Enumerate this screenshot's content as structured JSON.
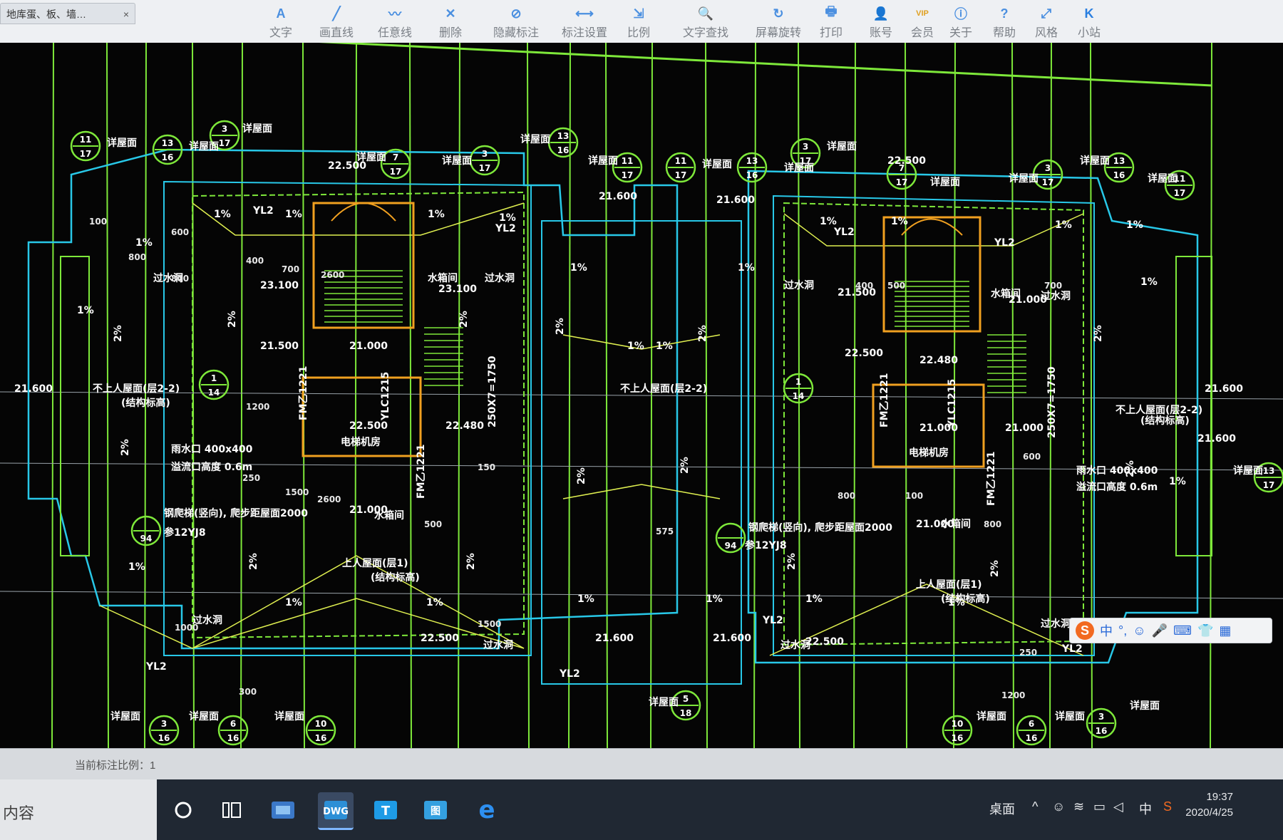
{
  "window": {
    "doc_tab": "地库蛋、板、墙…"
  },
  "toolbar": {
    "items": [
      {
        "label": "文字",
        "icon": "text-icon"
      },
      {
        "label": "画直线",
        "icon": "line-icon"
      },
      {
        "label": "任意线",
        "icon": "polyline-icon"
      },
      {
        "label": "删除",
        "icon": "delete-icon"
      },
      {
        "label": "隐藏标注",
        "icon": "hide-dimension-icon"
      },
      {
        "label": "标注设置",
        "icon": "dimension-settings-icon"
      },
      {
        "label": "比例",
        "icon": "scale-icon"
      },
      {
        "label": "文字查找",
        "icon": "text-search-icon"
      },
      {
        "label": "屏幕旋转",
        "icon": "rotate-screen-icon"
      },
      {
        "label": "打印",
        "icon": "print-icon"
      },
      {
        "label": "账号",
        "icon": "account-icon"
      },
      {
        "label": "会员",
        "icon": "vip-icon"
      },
      {
        "label": "关于",
        "icon": "info-icon"
      },
      {
        "label": "帮助",
        "icon": "help-icon"
      },
      {
        "label": "风格",
        "icon": "style-icon"
      },
      {
        "label": "小站",
        "icon": "k-station-icon"
      }
    ]
  },
  "drawing": {
    "elevations": [
      "22.500",
      "21.600",
      "21.600",
      "21.600",
      "23.100",
      "23.100",
      "21.500",
      "21.000",
      "21.500",
      "21.000",
      "22.500",
      "22.480",
      "22.500",
      "22.480",
      "21.000",
      "21.000",
      "21.600",
      "21.600",
      "22.500",
      "22.500",
      "22.500",
      "21.600",
      "21.600",
      "21.000",
      "21.000"
    ],
    "slopes": "1%",
    "slopes2": "2%",
    "labels": {
      "yl2": "YL2",
      "non_access_roof": "不上人屋面(层2-2)",
      "access_roof": "上人屋面(层1)",
      "structure_note": "(结构标高)",
      "drain": "过水洞",
      "water_tank": "水箱间",
      "elevator_room": "电梯机房",
      "scupper": "雨水口 400x400",
      "scupper_note": "溢流口高度 0.6m",
      "ladder_note": "钢爬梯(竖向), 爬步距屋面2000",
      "ladder_ref": "参12YJ8",
      "detail_ref": "详屋面",
      "door_fm": "FM乙1221",
      "door_ylc": "YLC1215",
      "stair_dim": "250X7=1750",
      "dims": [
        "400",
        "700",
        "800",
        "100",
        "800",
        "600",
        "1200",
        "250",
        "1500",
        "2600",
        "500",
        "150",
        "1000",
        "300",
        "575"
      ]
    },
    "callouts": [
      {
        "top": "11",
        "bottom": "17"
      },
      {
        "top": "13",
        "bottom": "16"
      },
      {
        "top": "3",
        "bottom": "17"
      },
      {
        "top": "7",
        "bottom": "17"
      },
      {
        "top": "3",
        "bottom": "17"
      },
      {
        "top": "13",
        "bottom": "16"
      },
      {
        "top": "11",
        "bottom": "17"
      },
      {
        "top": "11",
        "bottom": "17"
      },
      {
        "top": "13",
        "bottom": "16"
      },
      {
        "top": "3",
        "bottom": "17"
      },
      {
        "top": "7",
        "bottom": "17"
      },
      {
        "top": "3",
        "bottom": "17"
      },
      {
        "top": "13",
        "bottom": "16"
      },
      {
        "top": "11",
        "bottom": "17"
      },
      {
        "top": "1",
        "bottom": "14"
      },
      {
        "top": "1",
        "bottom": "14"
      },
      {
        "top": "13",
        "bottom": "17"
      },
      {
        "top": "3",
        "bottom": "16"
      },
      {
        "top": "6",
        "bottom": "16"
      },
      {
        "top": "10",
        "bottom": "16"
      },
      {
        "top": "5",
        "bottom": "18"
      },
      {
        "top": "10",
        "bottom": "16"
      },
      {
        "top": "6",
        "bottom": "16"
      },
      {
        "top": "3",
        "bottom": "16"
      },
      {
        "top": "",
        "bottom": "94"
      },
      {
        "top": "",
        "bottom": "94"
      }
    ]
  },
  "statusbar": {
    "scale_text": "当前标注比例：1"
  },
  "ime": {
    "lang": "中",
    "punct": "°,"
  },
  "taskbar": {
    "left_text": "内容",
    "desktop": "桌面",
    "ime_lang": "中",
    "time": "19:37",
    "date": "2020/4/25"
  }
}
